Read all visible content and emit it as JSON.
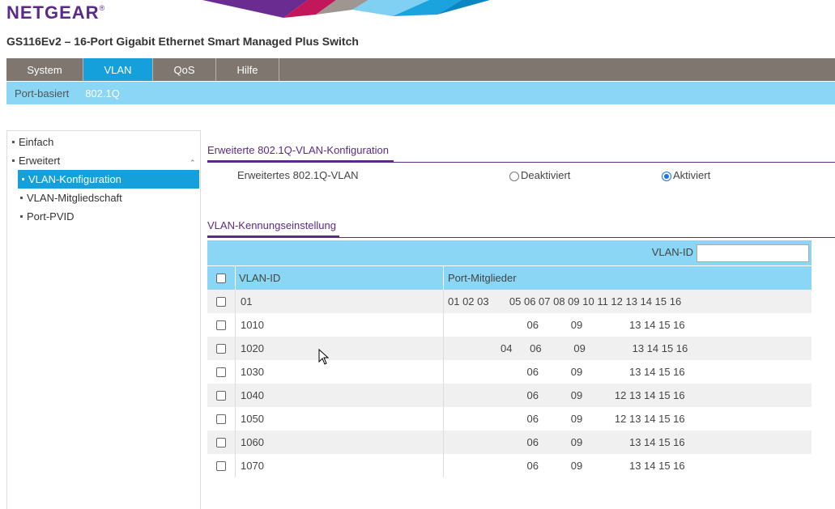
{
  "header": {
    "brand": "NETGEAR",
    "brand_mark": "®",
    "device_title": "GS116Ev2 – 16-Port Gigabit Ethernet Smart Managed Plus Switch"
  },
  "main_nav": {
    "tabs": [
      {
        "label": "System",
        "active": false
      },
      {
        "label": "VLAN",
        "active": true
      },
      {
        "label": "QoS",
        "active": false
      },
      {
        "label": "Hilfe",
        "active": false
      }
    ]
  },
  "sub_nav": {
    "items": [
      {
        "label": "Port-basiert",
        "active": false
      },
      {
        "label": "802.1Q",
        "active": true
      }
    ]
  },
  "sidebar": {
    "einfach": "Einfach",
    "erweitert": "Erweitert",
    "items": [
      {
        "label": "VLAN-Konfiguration",
        "active": true
      },
      {
        "label": "VLAN-Mitgliedschaft",
        "active": false
      },
      {
        "label": "Port-PVID",
        "active": false
      }
    ]
  },
  "config": {
    "section_title": "Erweiterte 802.1Q-VLAN-Konfiguration",
    "setting_label": "Erweitertes 802.1Q-VLAN",
    "option_off": "Deaktiviert",
    "option_on": "Aktiviert",
    "selected": "Aktiviert"
  },
  "vlan_table": {
    "section_title": "VLAN-Kennungseinstellung",
    "filter_label": "VLAN-ID",
    "filter_value": "",
    "col_id": "VLAN-ID",
    "col_ports": "Port-Mitglieder",
    "rows": [
      {
        "id": "01",
        "ports": "01 02 03       05 06 07 08 09 10 11 12 13 14 15 16"
      },
      {
        "id": "1010",
        "ports": "                           06           09                13 14 15 16"
      },
      {
        "id": "1020",
        "ports": "                  04      06           09                13 14 15 16"
      },
      {
        "id": "1030",
        "ports": "                           06           09                13 14 15 16"
      },
      {
        "id": "1040",
        "ports": "                           06           09           12 13 14 15 16"
      },
      {
        "id": "1050",
        "ports": "                           06           09           12 13 14 15 16"
      },
      {
        "id": "1060",
        "ports": "                           06           09                13 14 15 16"
      },
      {
        "id": "1070",
        "ports": "                           06           09                13 14 15 16"
      }
    ]
  }
}
